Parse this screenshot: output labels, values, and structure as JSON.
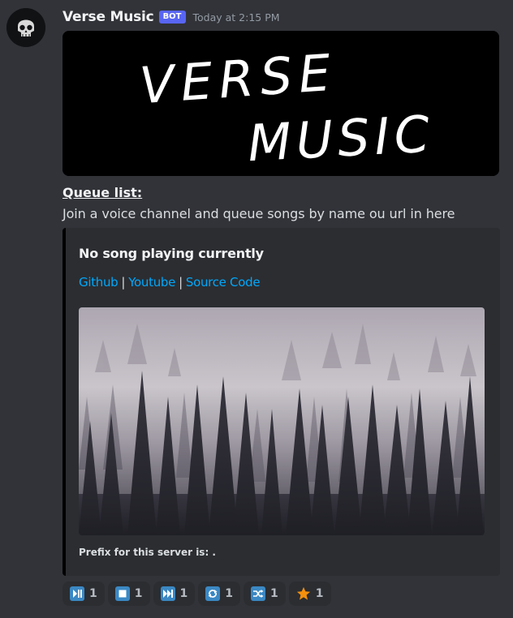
{
  "message": {
    "author": "Verse Music",
    "bot_tag": "BOT",
    "timestamp": "Today at 2:15 PM",
    "avatar_icon": "skull-icon",
    "banner_text_line1": "VERSE",
    "banner_text_line2": "MUSIC",
    "queue_title": "Queue list:",
    "queue_description": "Join a voice channel and queue songs by name ou url in here"
  },
  "embed": {
    "accent_color": "#000000",
    "title": "No song playing currently",
    "links": [
      {
        "label": "Github"
      },
      {
        "label": "Youtube"
      },
      {
        "label": "Source Code"
      }
    ],
    "separator": "|",
    "image_description_icon": "foggy-forest-image",
    "footer": "Prefix for this server is: ."
  },
  "reactions": [
    {
      "icon": "play-pause-icon",
      "count": "1"
    },
    {
      "icon": "stop-icon",
      "count": "1"
    },
    {
      "icon": "next-track-icon",
      "count": "1"
    },
    {
      "icon": "repeat-icon",
      "count": "1"
    },
    {
      "icon": "shuffle-icon",
      "count": "1"
    },
    {
      "icon": "star-icon",
      "count": "1"
    }
  ],
  "colors": {
    "background": "#313338",
    "embed_bg": "#2b2d31",
    "link": "#00a8fc",
    "bot_tag": "#5865f2",
    "emoji_blue": "#3b88c3",
    "star": "#f4900c"
  }
}
